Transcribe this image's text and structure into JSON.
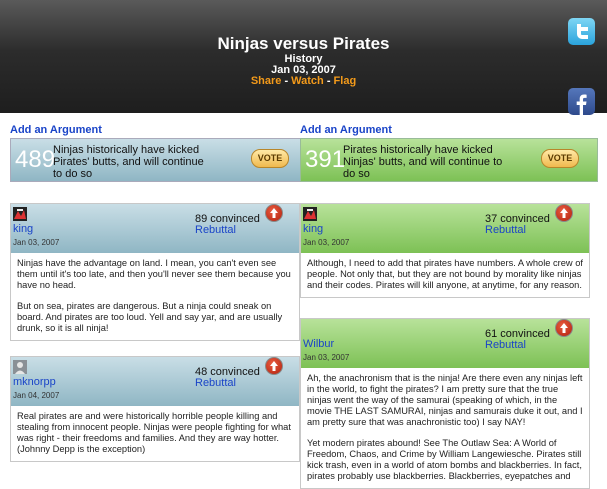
{
  "header": {
    "title": "Ninjas versus Pirates",
    "category": "History",
    "date": "Jan 03, 2007",
    "share": "Share",
    "watch": "Watch",
    "flag": "Flag",
    "separator": " - "
  },
  "social": {
    "twitter_icon": "twitter-icon",
    "facebook_icon": "facebook-icon"
  },
  "left": {
    "add_argument": "Add an Argument",
    "stance_count": "489",
    "stance_text": "Ninjas historically have kicked Pirates' butts, and will continue to do so",
    "vote_label": "VOTE",
    "arguments": [
      {
        "user": "king",
        "date": "Jan 03, 2007",
        "convinced": "89 convinced",
        "rebuttal": "Rebuttal",
        "paragraphs": [
          "Ninjas have the advantage on land. I mean, you can't even see them until it's too late, and then you'll never see them because you have no head.",
          "But on sea, pirates are dangerous. But a ninja could sneak on board. And pirates are too loud. Yell and say yar, and are usually drunk, so it is all ninja!"
        ]
      },
      {
        "user": "mknorpp",
        "date": "Jan 04, 2007",
        "convinced": "48 convinced",
        "rebuttal": "Rebuttal",
        "paragraphs": [
          "Real pirates are and were historically horrible people killing and stealing from innocent people. Ninjas were people fighting for what was right - their freedoms and families. And they are way hotter. (Johnny Depp is the exception)"
        ]
      }
    ]
  },
  "right": {
    "add_argument": "Add an Argument",
    "stance_count": "391",
    "stance_text": "Pirates historically have kicked Ninjas' butts, and will continue to do so",
    "vote_label": "VOTE",
    "arguments": [
      {
        "user": "king",
        "date": "Jan 03, 2007",
        "convinced": "37 convinced",
        "rebuttal": "Rebuttal",
        "paragraphs": [
          "Although, I need to add that pirates have numbers. A whole crew of people. Not only that, but they are not bound by morality like ninjas and their codes. Pirates will kill anyone, at anytime, for any reason."
        ]
      },
      {
        "user": "Wilbur",
        "date": "Jan 03, 2007",
        "convinced": "61 convinced",
        "rebuttal": "Rebuttal",
        "paragraphs": [
          "Ah, the anachronism that is the ninja! Are there even any ninjas left in the world, to fight the pirates? I am pretty sure that the true ninjas went the way of the samurai (speaking of which, in the movie THE LAST SAMURAI, ninjas and samurais duke it out, and I am pretty sure that was anachronistic too) I say NAY!",
          "Yet modern pirates abound! See The Outlaw Sea: A World of Freedom, Chaos, and Crime by William Langewiesche. Pirates still kick trash, even in a world of atom bombs and blackberries. In fact, pirates probably use blackberries. Blackberries, eyepatches and"
        ]
      }
    ]
  }
}
